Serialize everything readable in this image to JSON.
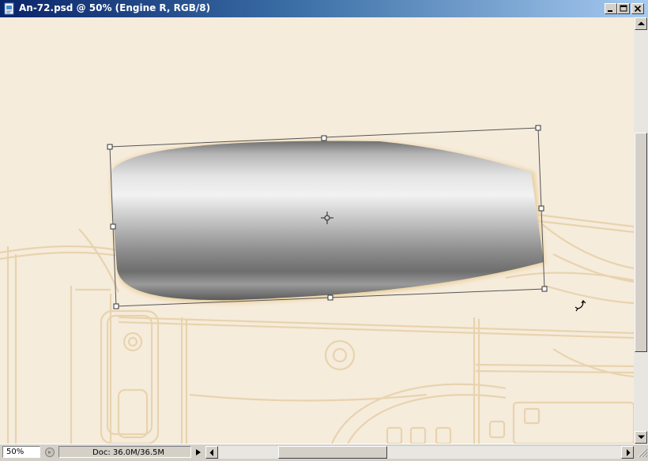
{
  "window": {
    "title": "An-72.psd @ 50% (Engine R, RGB/8)"
  },
  "controls": {
    "minimize_icon": "minimize-icon",
    "maximize_icon": "maximize-icon",
    "close_icon": "close-icon"
  },
  "status": {
    "zoom": "50%",
    "doc_info": "Doc: 36.0M/36.5M"
  },
  "canvas": {
    "background": "#f6ecdc",
    "sketch_color": "#e6cfa6",
    "layer_name": "Engine R"
  }
}
